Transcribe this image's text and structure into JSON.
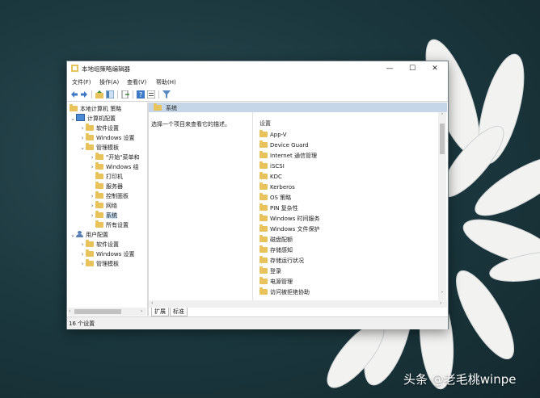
{
  "window": {
    "title": "本地组策略编辑器",
    "controls": {
      "minimize": "—",
      "maximize": "☐",
      "close": "✕"
    }
  },
  "menubar": [
    "文件(F)",
    "操作(A)",
    "查看(V)",
    "帮助(H)"
  ],
  "tree": {
    "root": "本地计算机 策略",
    "computer": "计算机配置",
    "computer_children": [
      "软件设置",
      "Windows 设置",
      "管理模板"
    ],
    "admin_children": [
      "\"开始\"菜单和",
      "Windows 组",
      "打印机",
      "服务器",
      "控制面板",
      "网络",
      "系统",
      "所有设置"
    ],
    "user": "用户配置",
    "user_children": [
      "软件设置",
      "Windows 设置",
      "管理模板"
    ]
  },
  "right_pane": {
    "header": "系统",
    "description": "选择一个项目来查看它的描述。",
    "column_header": "设置",
    "items": [
      "App-V",
      "Device Guard",
      "Internet 通信管理",
      "iSCSI",
      "KDC",
      "Kerberos",
      "OS 策略",
      "PIN 复杂性",
      "Windows 时间服务",
      "Windows 文件保护",
      "磁盘配额",
      "存储感知",
      "存储运行状况",
      "登录",
      "电源管理",
      "访问被拒绝协助"
    ]
  },
  "tabs": [
    "扩展",
    "标准"
  ],
  "status": "16 个设置",
  "watermark": "头条 @老毛桃winpe",
  "colors": {
    "folder": "#e8c25a",
    "header_bg": "#c5d6e8",
    "selection": "#cce4f7"
  }
}
